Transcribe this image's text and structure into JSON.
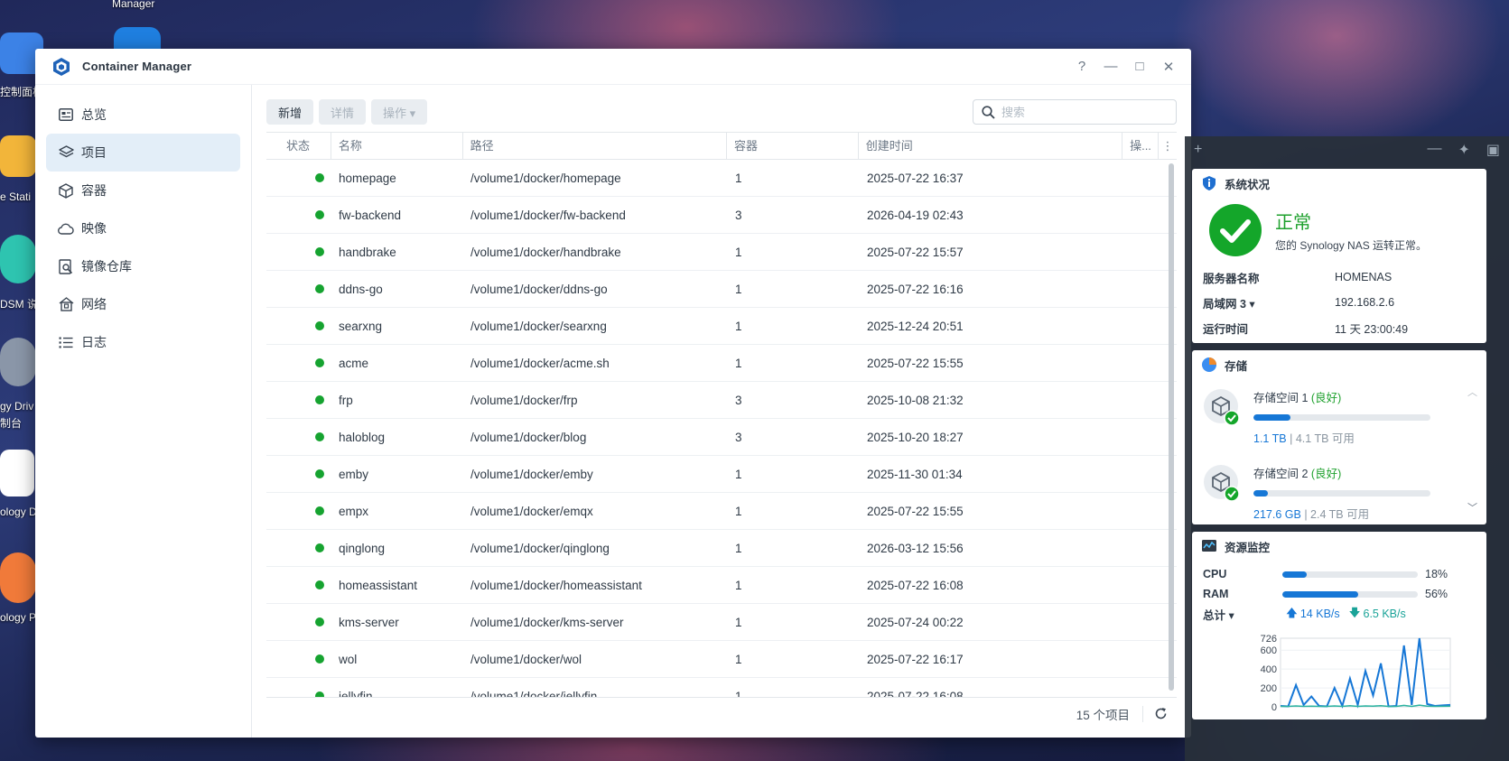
{
  "desktop": {
    "icons": [
      {
        "label": "Manager"
      },
      {
        "label": "控制面板"
      },
      {
        "label": "e Stati"
      },
      {
        "label": "DSM 说"
      },
      {
        "label": "gy Driv"
      },
      {
        "label": "制台"
      },
      {
        "label": "ology D"
      },
      {
        "label": "ology P"
      }
    ]
  },
  "window": {
    "title": "Container Manager",
    "controls": {
      "help": "?",
      "minimize": "—",
      "maximize": "□",
      "close": "✕"
    }
  },
  "sidebar": {
    "items": [
      {
        "label": "总览",
        "icon": "overview-icon",
        "active": false
      },
      {
        "label": "项目",
        "icon": "project-icon",
        "active": true
      },
      {
        "label": "容器",
        "icon": "container-icon",
        "active": false
      },
      {
        "label": "映像",
        "icon": "image-icon",
        "active": false
      },
      {
        "label": "镜像仓库",
        "icon": "registry-icon",
        "active": false
      },
      {
        "label": "网络",
        "icon": "network-icon",
        "active": false
      },
      {
        "label": "日志",
        "icon": "log-icon",
        "active": false
      }
    ]
  },
  "toolbar": {
    "create_label": "新增",
    "details_label": "详情",
    "action_label": "操作 ▾",
    "search_placeholder": "搜索"
  },
  "table": {
    "columns": {
      "status": "状态",
      "name": "名称",
      "path": "路径",
      "count": "容器",
      "created": "创建时间",
      "op": "操..."
    },
    "rows": [
      {
        "name": "homepage",
        "path": "/volume1/docker/homepage",
        "count": "1",
        "created": "2025-07-22 16:37"
      },
      {
        "name": "fw-backend",
        "path": "/volume1/docker/fw-backend",
        "count": "3",
        "created": "2026-04-19 02:43"
      },
      {
        "name": "handbrake",
        "path": "/volume1/docker/handbrake",
        "count": "1",
        "created": "2025-07-22 15:57"
      },
      {
        "name": "ddns-go",
        "path": "/volume1/docker/ddns-go",
        "count": "1",
        "created": "2025-07-22 16:16"
      },
      {
        "name": "searxng",
        "path": "/volume1/docker/searxng",
        "count": "1",
        "created": "2025-12-24 20:51"
      },
      {
        "name": "acme",
        "path": "/volume1/docker/acme.sh",
        "count": "1",
        "created": "2025-07-22 15:55"
      },
      {
        "name": "frp",
        "path": "/volume1/docker/frp",
        "count": "3",
        "created": "2025-10-08 21:32"
      },
      {
        "name": "haloblog",
        "path": "/volume1/docker/blog",
        "count": "3",
        "created": "2025-10-20 18:27"
      },
      {
        "name": "emby",
        "path": "/volume1/docker/emby",
        "count": "1",
        "created": "2025-11-30 01:34"
      },
      {
        "name": "empx",
        "path": "/volume1/docker/emqx",
        "count": "1",
        "created": "2025-07-22 15:55"
      },
      {
        "name": "qinglong",
        "path": "/volume1/docker/qinglong",
        "count": "1",
        "created": "2026-03-12 15:56"
      },
      {
        "name": "homeassistant",
        "path": "/volume1/docker/homeassistant",
        "count": "1",
        "created": "2025-07-22 16:08"
      },
      {
        "name": "kms-server",
        "path": "/volume1/docker/kms-server",
        "count": "1",
        "created": "2025-07-24 00:22"
      },
      {
        "name": "wol",
        "path": "/volume1/docker/wol",
        "count": "1",
        "created": "2025-07-22 16:17"
      },
      {
        "name": "jellyfin",
        "path": "/volume1/docker/jellyfin",
        "count": "1",
        "created": "2025-07-22 16:08"
      }
    ],
    "footer": {
      "count_label": "15 个项目"
    }
  },
  "widgets": {
    "system": {
      "title": "系统状况",
      "status": "正常",
      "status_desc": "您的 Synology NAS 运转正常。",
      "fields": [
        {
          "key": "服务器名称",
          "value": "HOMENAS"
        },
        {
          "key": "局域网 3 ▾",
          "value": "192.168.2.6"
        },
        {
          "key": "运行时间",
          "value": "11 天 23:00:49"
        }
      ]
    },
    "storage": {
      "title": "存储",
      "volumes": [
        {
          "name": "存储空间 1",
          "health": "良好",
          "used": "1.1 TB",
          "free": "4.1 TB 可用",
          "fill_pct": 21
        },
        {
          "name": "存储空间 2",
          "health": "良好",
          "used": "217.6 GB",
          "free": "2.4 TB 可用",
          "fill_pct": 8
        }
      ]
    },
    "resource": {
      "title": "资源监控",
      "cpu_label": "CPU",
      "cpu_pct": "18%",
      "cpu_value": 18,
      "ram_label": "RAM",
      "ram_pct": "56%",
      "ram_value": 56,
      "total_label": "总计 ▾",
      "upload": "14 KB/s",
      "download": "6.5 KB/s"
    },
    "chart_data": {
      "type": "line",
      "title": "",
      "ylim": [
        0,
        726
      ],
      "yticks": [
        "726",
        "600",
        "400",
        "200",
        "0"
      ],
      "series": [
        {
          "values": [
            10,
            5,
            230,
            20,
            110,
            10,
            5,
            200,
            10,
            300,
            20,
            380,
            120,
            460,
            5,
            10,
            650,
            20,
            726,
            30,
            10,
            15,
            20
          ]
        },
        {
          "values": [
            5,
            5,
            10,
            5,
            8,
            5,
            5,
            10,
            5,
            12,
            5,
            10,
            8,
            12,
            5,
            5,
            15,
            5,
            18,
            8,
            5,
            6,
            8
          ]
        }
      ],
      "colors": [
        "#1677d6",
        "#2bb3a0"
      ]
    }
  }
}
